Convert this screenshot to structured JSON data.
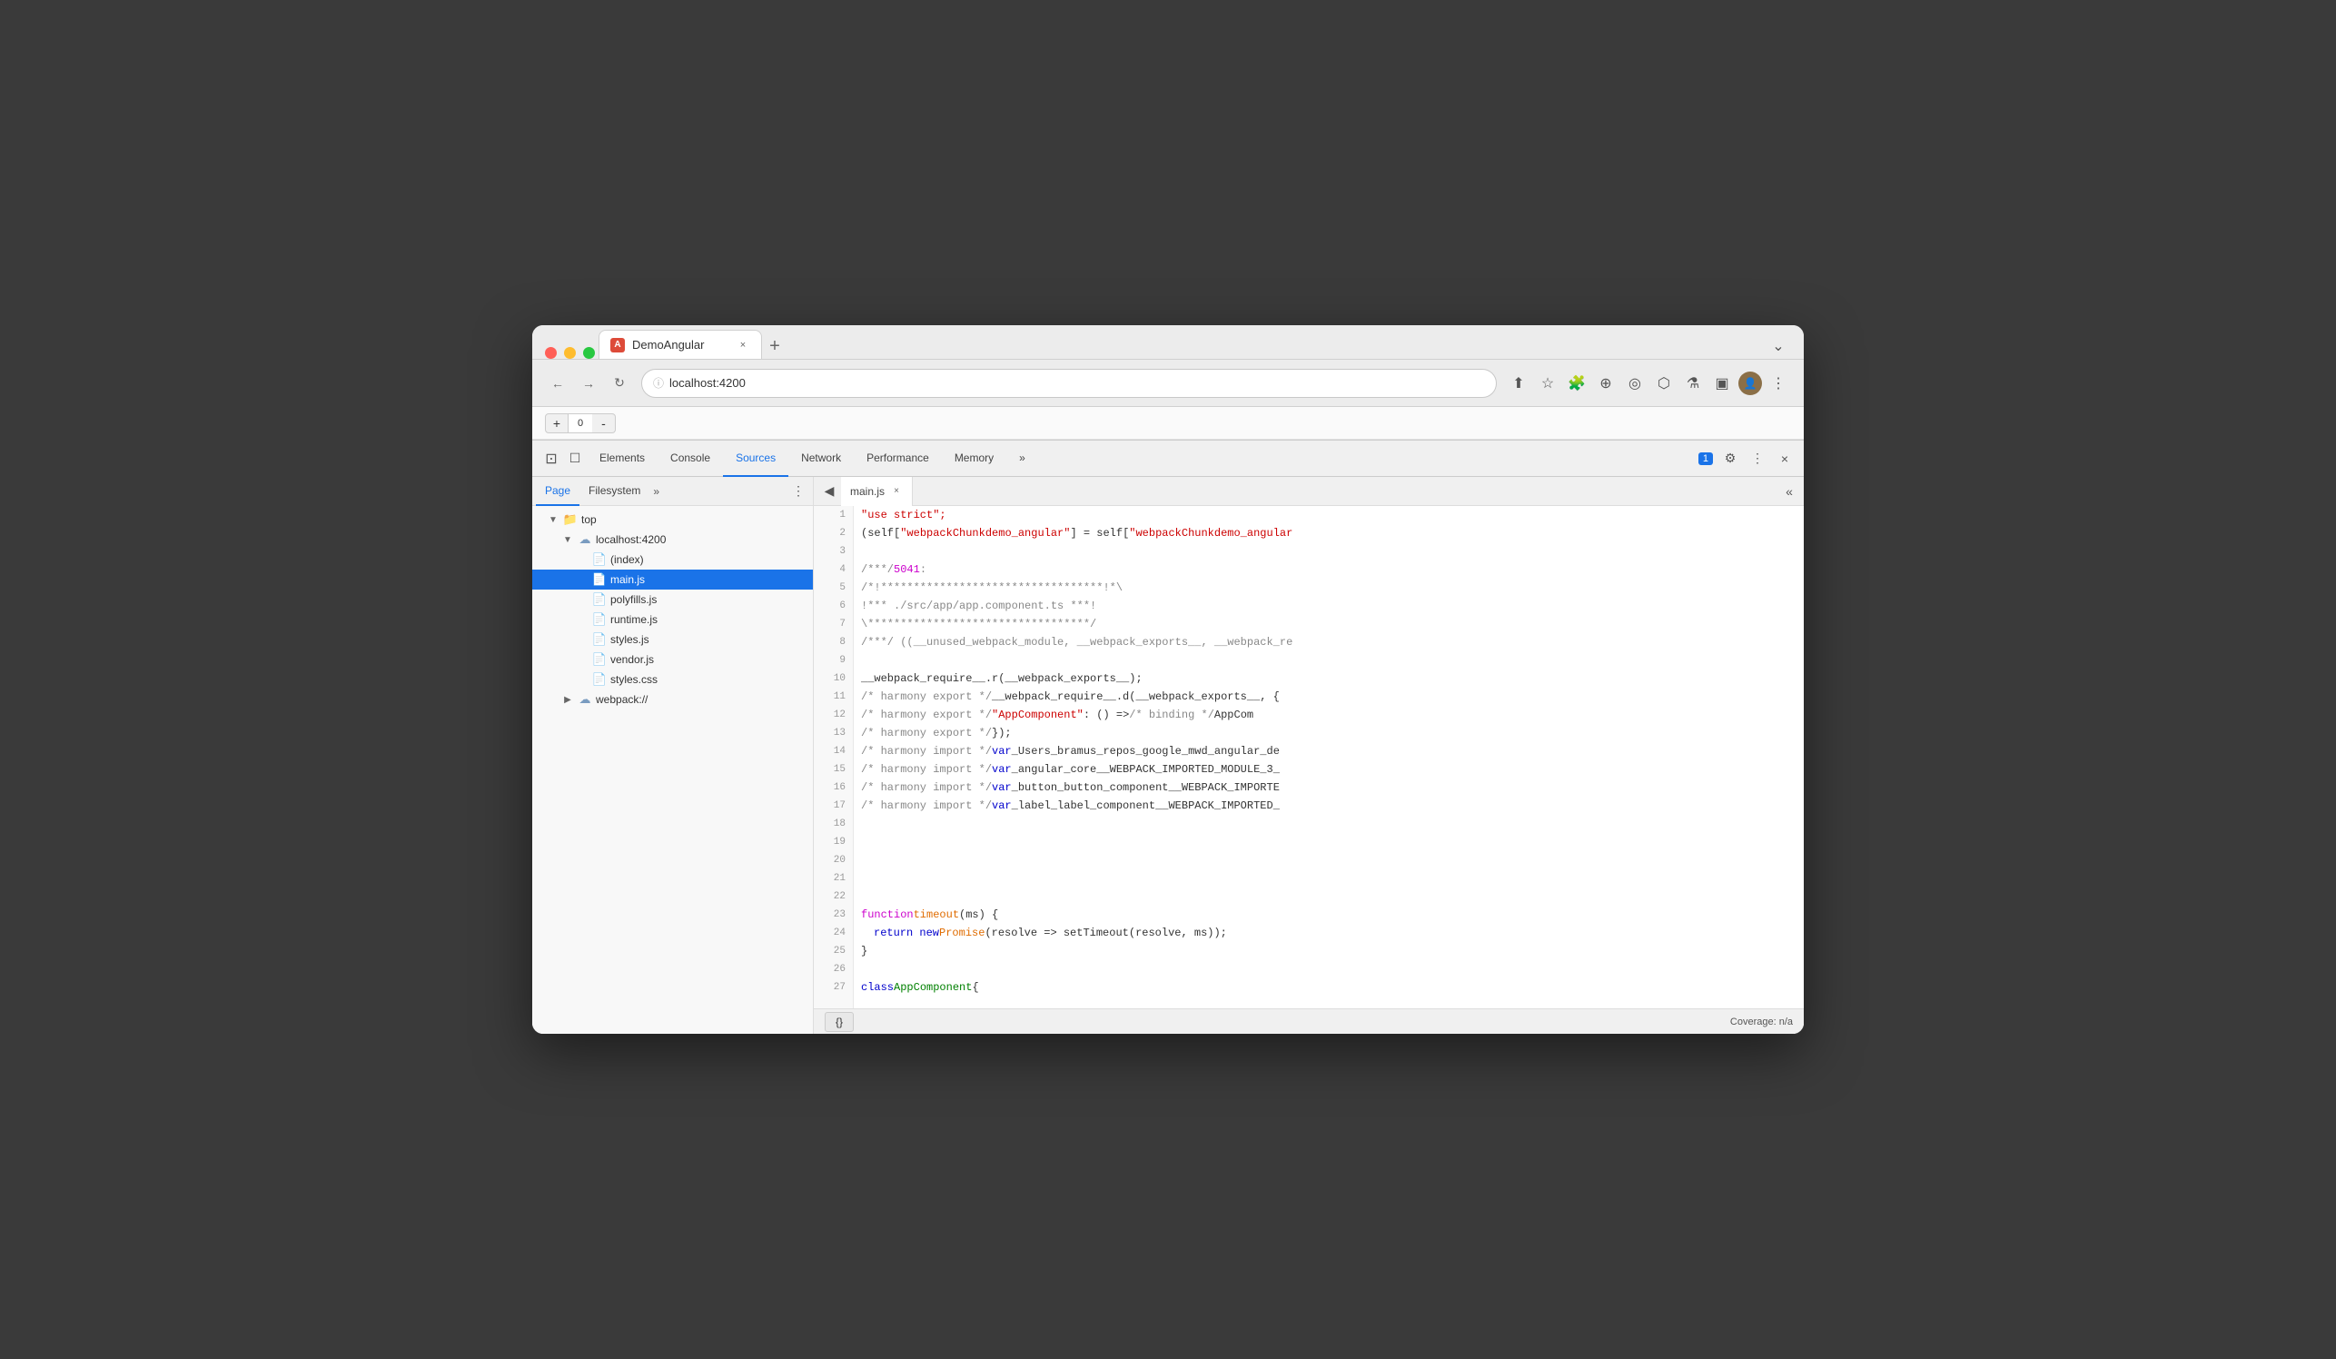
{
  "browser": {
    "traffic_lights": [
      "red",
      "yellow",
      "green"
    ],
    "tab_title": "DemoAngular",
    "tab_close": "×",
    "new_tab": "+",
    "address": "localhost:4200",
    "nav_back": "←",
    "nav_forward": "→",
    "nav_reload": "↻",
    "expand_btn": "⌄"
  },
  "devtools": {
    "tabs": [
      {
        "label": "Elements",
        "active": false
      },
      {
        "label": "Console",
        "active": false
      },
      {
        "label": "Sources",
        "active": true
      },
      {
        "label": "Network",
        "active": false
      },
      {
        "label": "Performance",
        "active": false
      },
      {
        "label": "Memory",
        "active": false
      }
    ],
    "more_tabs": "»",
    "console_badge": "1",
    "settings_icon": "⚙",
    "more_icon": "⋮",
    "close_icon": "×",
    "cursor_icon": "⊡",
    "phone_icon": "☐"
  },
  "file_tree": {
    "tabs": [
      {
        "label": "Page",
        "active": true
      },
      {
        "label": "Filesystem",
        "active": false
      }
    ],
    "more_tabs": "»",
    "menu_icon": "⋮",
    "items": [
      {
        "label": "top",
        "type": "folder",
        "level": 0,
        "expanded": true,
        "arrow": "▼"
      },
      {
        "label": "localhost:4200",
        "type": "cloud",
        "level": 1,
        "expanded": true,
        "arrow": "▼"
      },
      {
        "label": "(index)",
        "type": "file-gray",
        "level": 2,
        "selected": false
      },
      {
        "label": "main.js",
        "type": "file-yellow",
        "level": 2,
        "selected": true
      },
      {
        "label": "polyfills.js",
        "type": "file-yellow",
        "level": 2,
        "selected": false
      },
      {
        "label": "runtime.js",
        "type": "file-yellow",
        "level": 2,
        "selected": false
      },
      {
        "label": "styles.js",
        "type": "file-yellow",
        "level": 2,
        "selected": false
      },
      {
        "label": "vendor.js",
        "type": "file-yellow",
        "level": 2,
        "selected": false
      },
      {
        "label": "styles.css",
        "type": "file-purple",
        "level": 2,
        "selected": false
      },
      {
        "label": "webpack://",
        "type": "cloud",
        "level": 1,
        "expanded": false,
        "arrow": "▶"
      }
    ]
  },
  "editor": {
    "tab_label": "main.js",
    "tab_close": "×",
    "collapse_icon": "«",
    "lines": [
      {
        "num": 1,
        "code": [
          {
            "t": "\"use strict\";",
            "c": "kw-red"
          }
        ]
      },
      {
        "num": 2,
        "code": [
          {
            "t": "(self[",
            "c": "kw-white"
          },
          {
            "t": "\"webpackChunkdemo_angular\"",
            "c": "kw-red"
          },
          {
            "t": "] = self[",
            "c": "kw-white"
          },
          {
            "t": "\"webpackChunkdemo_angular",
            "c": "kw-red"
          }
        ]
      },
      {
        "num": 3,
        "code": []
      },
      {
        "num": 4,
        "code": [
          {
            "t": "/***/ ",
            "c": "kw-comment"
          },
          {
            "t": "5041",
            "c": "kw-pink"
          },
          {
            "t": ":",
            "c": "kw-comment"
          }
        ]
      },
      {
        "num": 5,
        "code": [
          {
            "t": "/*!**********************************!*\\",
            "c": "kw-comment"
          }
        ]
      },
      {
        "num": 6,
        "code": [
          {
            "t": "  !*** ./src/app/app.component.ts ***!",
            "c": "kw-comment"
          }
        ]
      },
      {
        "num": 7,
        "code": [
          {
            "t": "  \\**********************************/",
            "c": "kw-comment"
          }
        ]
      },
      {
        "num": 8,
        "code": [
          {
            "t": "/***/ ",
            "c": "kw-comment"
          },
          {
            "t": "((__unused_webpack_module, __webpack_exports__, __webpack_re",
            "c": "kw-comment"
          }
        ]
      },
      {
        "num": 9,
        "code": []
      },
      {
        "num": 10,
        "code": [
          {
            "t": "__webpack_require__.r(__webpack_exports__);",
            "c": "kw-white"
          }
        ]
      },
      {
        "num": 11,
        "code": [
          {
            "t": "/* harmony export */ ",
            "c": "kw-comment"
          },
          {
            "t": "__webpack_require__.d(__webpack_exports__, {",
            "c": "kw-white"
          }
        ]
      },
      {
        "num": 12,
        "code": [
          {
            "t": "/* harmony export */   ",
            "c": "kw-comment"
          },
          {
            "t": "\"AppComponent\"",
            "c": "kw-red"
          },
          {
            "t": ": () => ",
            "c": "kw-white"
          },
          {
            "t": "/* binding */",
            "c": "kw-comment"
          },
          {
            "t": " AppCom",
            "c": "kw-white"
          }
        ]
      },
      {
        "num": 13,
        "code": [
          {
            "t": "/* harmony export */ ",
            "c": "kw-comment"
          },
          {
            "t": "});",
            "c": "kw-white"
          }
        ]
      },
      {
        "num": 14,
        "code": [
          {
            "t": "/* harmony import */ ",
            "c": "kw-comment"
          },
          {
            "t": "var ",
            "c": "kw-blue"
          },
          {
            "t": "_Users_bramus_repos_google_mwd_angular_de",
            "c": "kw-white"
          }
        ]
      },
      {
        "num": 15,
        "code": [
          {
            "t": "/* harmony import */ ",
            "c": "kw-comment"
          },
          {
            "t": "var ",
            "c": "kw-blue"
          },
          {
            "t": "_angular_core__WEBPACK_IMPORTED_MODULE_3_",
            "c": "kw-white"
          }
        ]
      },
      {
        "num": 16,
        "code": [
          {
            "t": "/* harmony import */ ",
            "c": "kw-comment"
          },
          {
            "t": "var ",
            "c": "kw-blue"
          },
          {
            "t": "_button_button_component__WEBPACK_IMPORTE",
            "c": "kw-white"
          }
        ]
      },
      {
        "num": 17,
        "code": [
          {
            "t": "/* harmony import */ ",
            "c": "kw-comment"
          },
          {
            "t": "var ",
            "c": "kw-blue"
          },
          {
            "t": "_label_label_component__WEBPACK_IMPORTED_",
            "c": "kw-white"
          }
        ]
      },
      {
        "num": 18,
        "code": []
      },
      {
        "num": 19,
        "code": []
      },
      {
        "num": 20,
        "code": []
      },
      {
        "num": 21,
        "code": []
      },
      {
        "num": 22,
        "code": []
      },
      {
        "num": 23,
        "code": [
          {
            "t": "function ",
            "c": "kw-pink"
          },
          {
            "t": "timeout",
            "c": "kw-orange"
          },
          {
            "t": "(ms) {",
            "c": "kw-white"
          }
        ]
      },
      {
        "num": 24,
        "code": [
          {
            "t": "  return ",
            "c": "kw-blue"
          },
          {
            "t": "new ",
            "c": "kw-blue"
          },
          {
            "t": "Promise",
            "c": "kw-orange"
          },
          {
            "t": "(resolve => setTimeout(resolve, ms));",
            "c": "kw-white"
          }
        ]
      },
      {
        "num": 25,
        "code": [
          {
            "t": "}",
            "c": "kw-white"
          }
        ]
      },
      {
        "num": 26,
        "code": []
      },
      {
        "num": 27,
        "code": [
          {
            "t": "class ",
            "c": "kw-blue"
          },
          {
            "t": "AppComponent",
            "c": "kw-green"
          },
          {
            "t": " {",
            "c": "kw-white"
          }
        ]
      }
    ],
    "statusbar": {
      "curly_label": "{}",
      "coverage": "Coverage: n/a"
    }
  },
  "zoom": {
    "minus": "-",
    "value": "0",
    "plus": "+"
  }
}
